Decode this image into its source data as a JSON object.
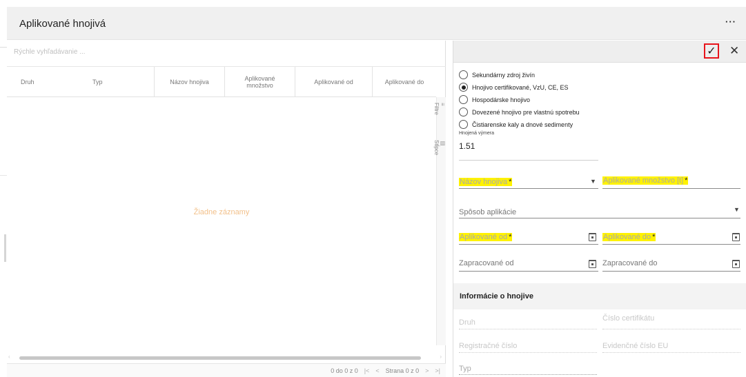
{
  "header": {
    "title": "Aplikované hnojivá",
    "more": "···"
  },
  "grid": {
    "search_placeholder": "Rýchle vyhľadávanie ...",
    "columns": [
      "Druh",
      "Typ",
      "Názov hnojiva",
      "Aplikované množstvo",
      "Aplikované od",
      "Aplikované do"
    ],
    "empty_message": "Žiadne záznamy",
    "tools": {
      "filter": "Filtre",
      "columns": "Stĺpce"
    },
    "pager": {
      "range": "0 do 0 z 0",
      "first": "|<",
      "prev": "<",
      "page_text": "Strana 0 z 0",
      "next": ">",
      "last": ">|"
    }
  },
  "form": {
    "confirm": "✓",
    "close": "✕",
    "radio_options": [
      {
        "label": "Sekundárny zdroj živín",
        "selected": false
      },
      {
        "label": "Hnojivo certifikované, VzU, CE, ES",
        "selected": true
      },
      {
        "label": "Hospodárske hnojivo",
        "selected": false
      },
      {
        "label": "Dovezené hnojivo pre vlastnú spotrebu",
        "selected": false
      },
      {
        "label": "Čistiarenske kaly a dnové sedimenty",
        "selected": false
      }
    ],
    "area_label": "Hnojená výmera",
    "area_value": "1.51",
    "fertilizer_name": {
      "label": "Názov hnojiva",
      "required": "*"
    },
    "applied_amount": {
      "label": "Aplikované množstvo [t]",
      "required": "*"
    },
    "application_method": {
      "label": "Spôsob aplikácie"
    },
    "applied_from": {
      "label": "Aplikované od",
      "required": "*"
    },
    "applied_to": {
      "label": "Aplikované do",
      "required": "*"
    },
    "processed_from": {
      "label": "Zapracované od"
    },
    "processed_to": {
      "label": "Zapracované do"
    },
    "info": {
      "title": "Informácie o hnojive",
      "druh": "Druh",
      "certificate": "Číslo certifikátu",
      "registration": "Registračné číslo",
      "eu_number": "Evidenčné číslo EU",
      "typ": "Typ"
    }
  },
  "colors": {
    "highlight": "#fff200",
    "confirm_border": "#e8141b",
    "empty_text": "#f2c08a"
  }
}
